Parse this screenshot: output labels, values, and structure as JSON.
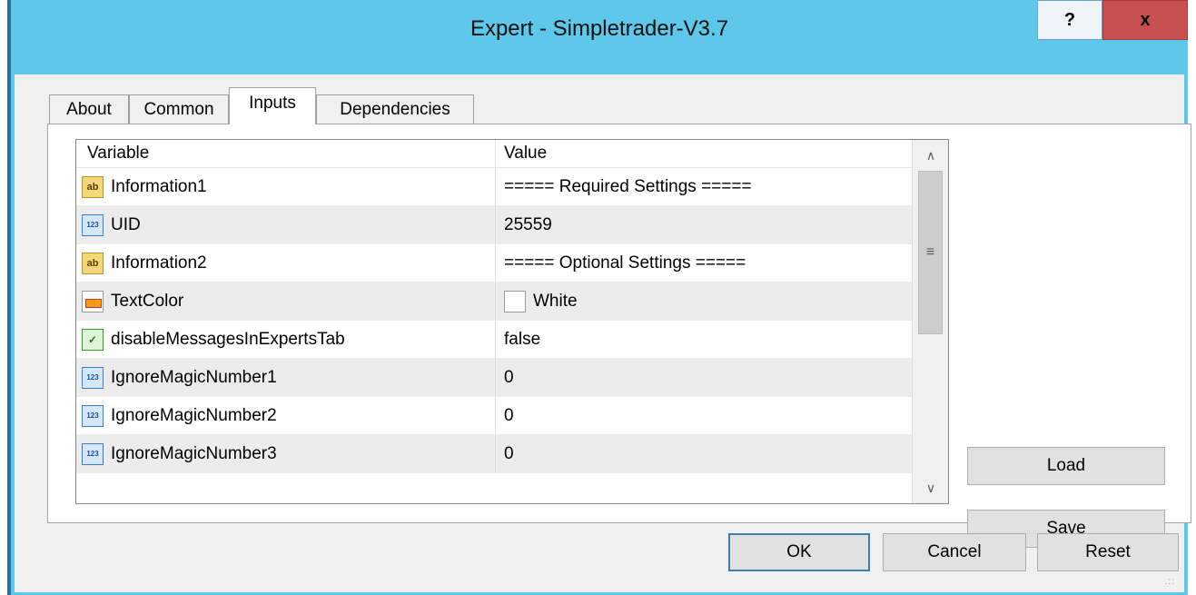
{
  "window": {
    "title": "Expert - Simpletrader-V3.7",
    "help_label": "?",
    "close_label": "x"
  },
  "tabs": [
    {
      "label": "About"
    },
    {
      "label": "Common"
    },
    {
      "label": "Inputs"
    },
    {
      "label": "Dependencies"
    }
  ],
  "active_tab": "Inputs",
  "grid": {
    "headers": {
      "variable": "Variable",
      "value": "Value"
    },
    "rows": [
      {
        "icon": "ab-string-icon",
        "variable": "Information1",
        "value": "===== Required Settings ====="
      },
      {
        "icon": "123-number-icon",
        "variable": "UID",
        "value": "25559"
      },
      {
        "icon": "ab-string-icon",
        "variable": "Information2",
        "value": "===== Optional Settings ====="
      },
      {
        "icon": "color-icon",
        "variable": "TextColor",
        "value": "White",
        "swatch": "#ffffff"
      },
      {
        "icon": "bool-icon",
        "variable": "disableMessagesInExpertsTab",
        "value": "false"
      },
      {
        "icon": "123-number-icon",
        "variable": "IgnoreMagicNumber1",
        "value": "0"
      },
      {
        "icon": "123-number-icon",
        "variable": "IgnoreMagicNumber2",
        "value": "0"
      },
      {
        "icon": "123-number-icon",
        "variable": "IgnoreMagicNumber3",
        "value": "0"
      }
    ]
  },
  "buttons": {
    "load": "Load",
    "save": "Save",
    "ok": "OK",
    "cancel": "Cancel",
    "reset": "Reset"
  },
  "colors": {
    "titlebar": "#5ec8ea",
    "close": "#c75050",
    "alt_row": "#ececec"
  }
}
